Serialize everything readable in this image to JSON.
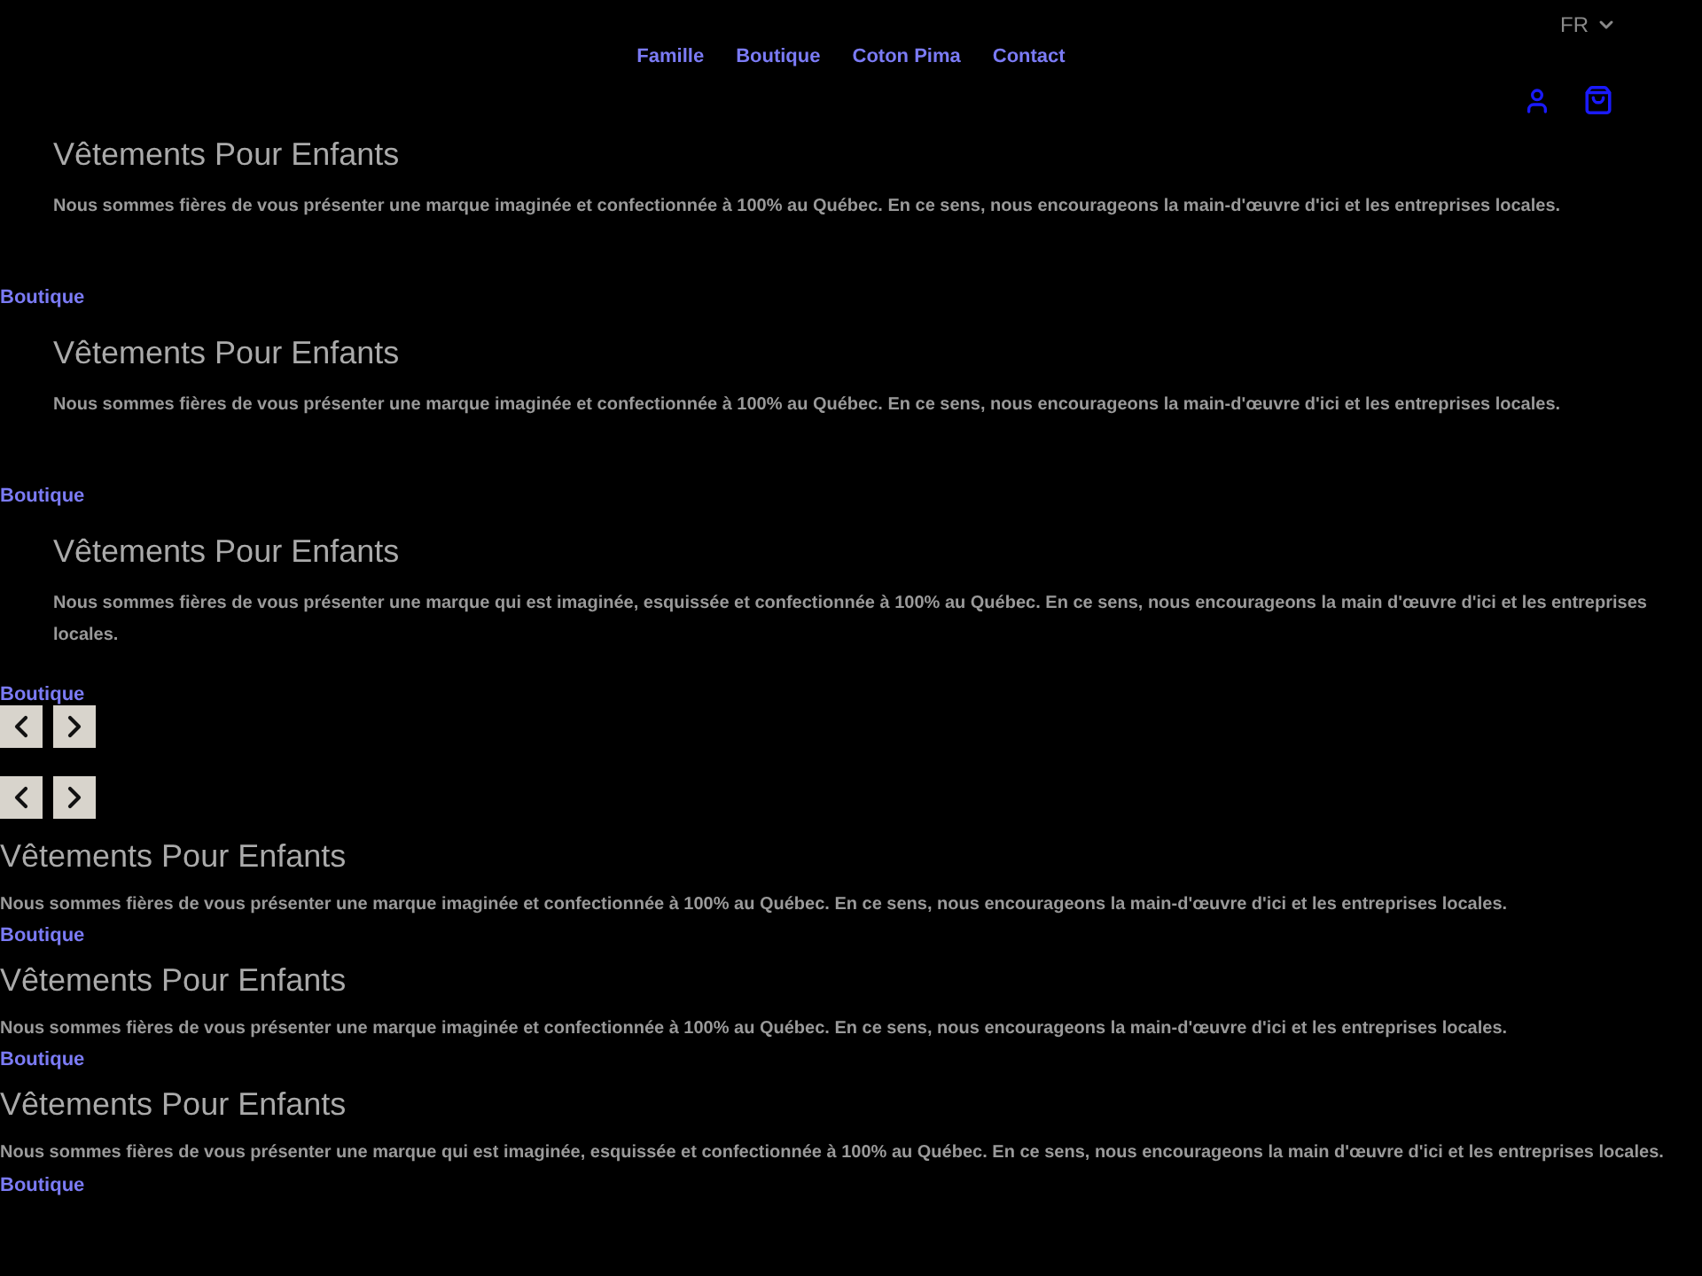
{
  "language": {
    "label": "FR"
  },
  "nav": [
    {
      "label": "Famille"
    },
    {
      "label": "Boutique"
    },
    {
      "label": "Coton Pima"
    },
    {
      "label": "Contact"
    }
  ],
  "slides": [
    {
      "title": "Vêtements Pour Enfants",
      "text": "Nous sommes fières de vous présenter une marque imaginée et confectionnée à 100% au Québec. En ce sens, nous encourageons la main-d'œuvre d'ici et les entreprises locales.",
      "link": "Boutique"
    },
    {
      "title": "Vêtements Pour Enfants",
      "text": "Nous sommes fières de vous présenter une marque imaginée et confectionnée à 100% au Québec. En ce sens, nous encourageons la main-d'œuvre d'ici et les entreprises locales.",
      "link": "Boutique"
    },
    {
      "title": "Vêtements Pour Enfants",
      "text": "Nous sommes fières de vous présenter une marque qui est imaginée, esquissée et confectionnée à 100% au Québec. En ce sens, nous encourageons la main d'œuvre d'ici et les entreprises locales.",
      "link": "Boutique"
    }
  ],
  "slides_mobile": [
    {
      "title": "Vêtements Pour Enfants",
      "text": "Nous sommes fières de vous présenter une marque imaginée et confectionnée à 100% au Québec. En ce sens, nous encourageons la main-d'œuvre d'ici et les entreprises locales.",
      "link": "Boutique"
    },
    {
      "title": "Vêtements Pour Enfants",
      "text": "Nous sommes fières de vous présenter une marque imaginée et confectionnée à 100% au Québec. En ce sens, nous encourageons la main-d'œuvre d'ici et les entreprises locales.",
      "link": "Boutique"
    },
    {
      "title": "Vêtements Pour Enfants",
      "text": "Nous sommes fières de vous présenter une marque qui est imaginée, esquissée et confectionnée à 100% au Québec. En ce sens, nous encourageons la main d'œuvre d'ici et les entreprises locales.",
      "link": "Boutique"
    }
  ]
}
